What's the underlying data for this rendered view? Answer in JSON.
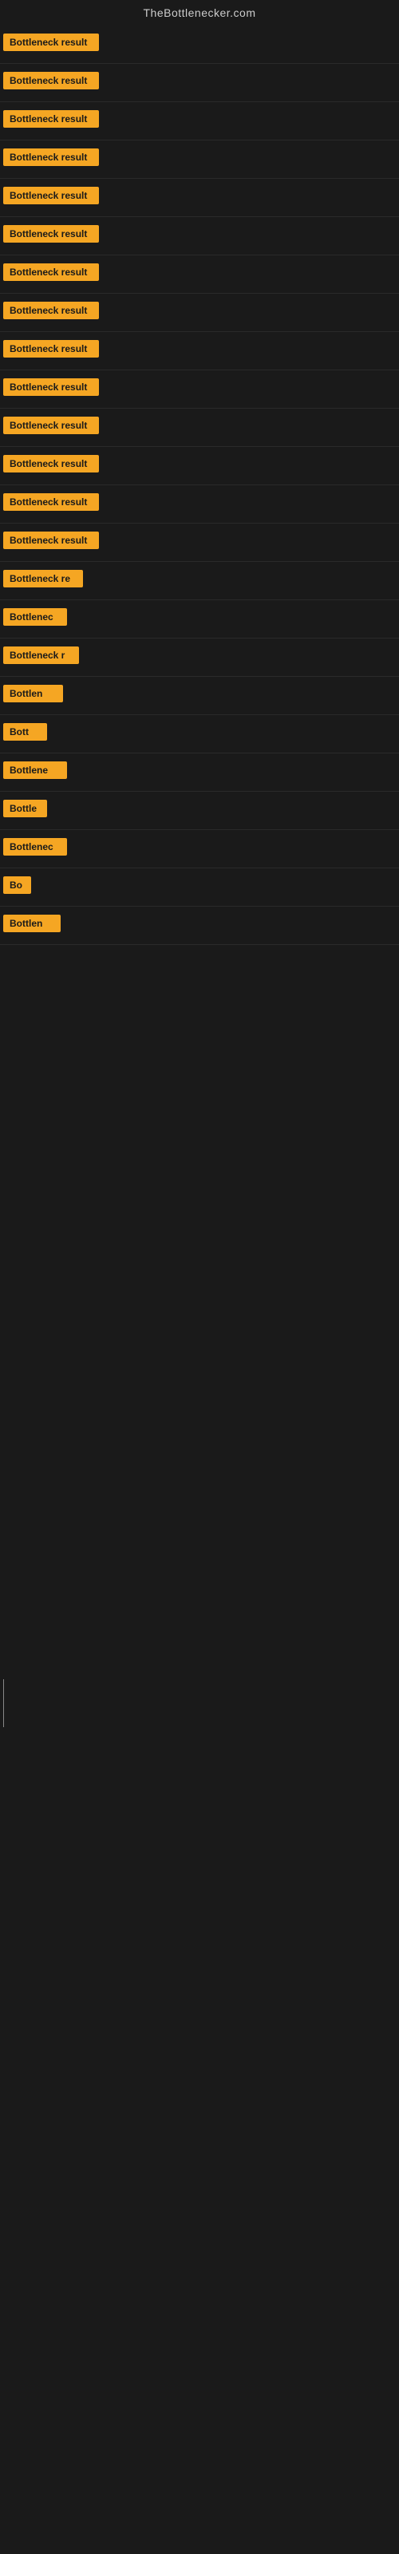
{
  "site": {
    "title": "TheBottlenecker.com"
  },
  "rows": [
    {
      "id": 1,
      "label": "Bottleneck result"
    },
    {
      "id": 2,
      "label": "Bottleneck result"
    },
    {
      "id": 3,
      "label": "Bottleneck result"
    },
    {
      "id": 4,
      "label": "Bottleneck result"
    },
    {
      "id": 5,
      "label": "Bottleneck result"
    },
    {
      "id": 6,
      "label": "Bottleneck result"
    },
    {
      "id": 7,
      "label": "Bottleneck result"
    },
    {
      "id": 8,
      "label": "Bottleneck result"
    },
    {
      "id": 9,
      "label": "Bottleneck result"
    },
    {
      "id": 10,
      "label": "Bottleneck result"
    },
    {
      "id": 11,
      "label": "Bottleneck result"
    },
    {
      "id": 12,
      "label": "Bottleneck result"
    },
    {
      "id": 13,
      "label": "Bottleneck result"
    },
    {
      "id": 14,
      "label": "Bottleneck result"
    },
    {
      "id": 15,
      "label": "Bottleneck re"
    },
    {
      "id": 16,
      "label": "Bottlenec"
    },
    {
      "id": 17,
      "label": "Bottleneck r"
    },
    {
      "id": 18,
      "label": "Bottlen"
    },
    {
      "id": 19,
      "label": "Bott"
    },
    {
      "id": 20,
      "label": "Bottlene"
    },
    {
      "id": 21,
      "label": "Bottle"
    },
    {
      "id": 22,
      "label": "Bottlenec"
    },
    {
      "id": 23,
      "label": "Bo"
    },
    {
      "id": 24,
      "label": "Bottlen"
    }
  ]
}
